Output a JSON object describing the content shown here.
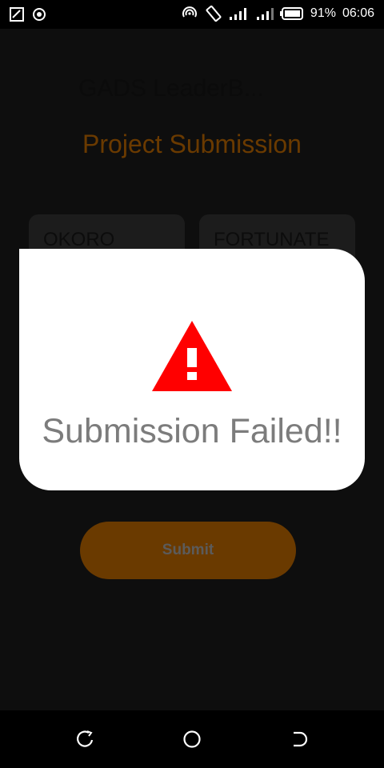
{
  "status_bar": {
    "battery_percent": "91%",
    "time": "06:06"
  },
  "app": {
    "title": "GADS LeaderB...",
    "screen_title": "Project Submission",
    "fields": [
      {
        "value": "OKORO"
      },
      {
        "value": "FORTUNATE"
      }
    ],
    "submit_label": "Submit"
  },
  "dialog": {
    "message": "Submission Failed!!",
    "icon": "warning-icon",
    "icon_color": "#ff0000"
  },
  "colors": {
    "accent": "#6a3a00",
    "overlay": "#0e0e0e"
  }
}
